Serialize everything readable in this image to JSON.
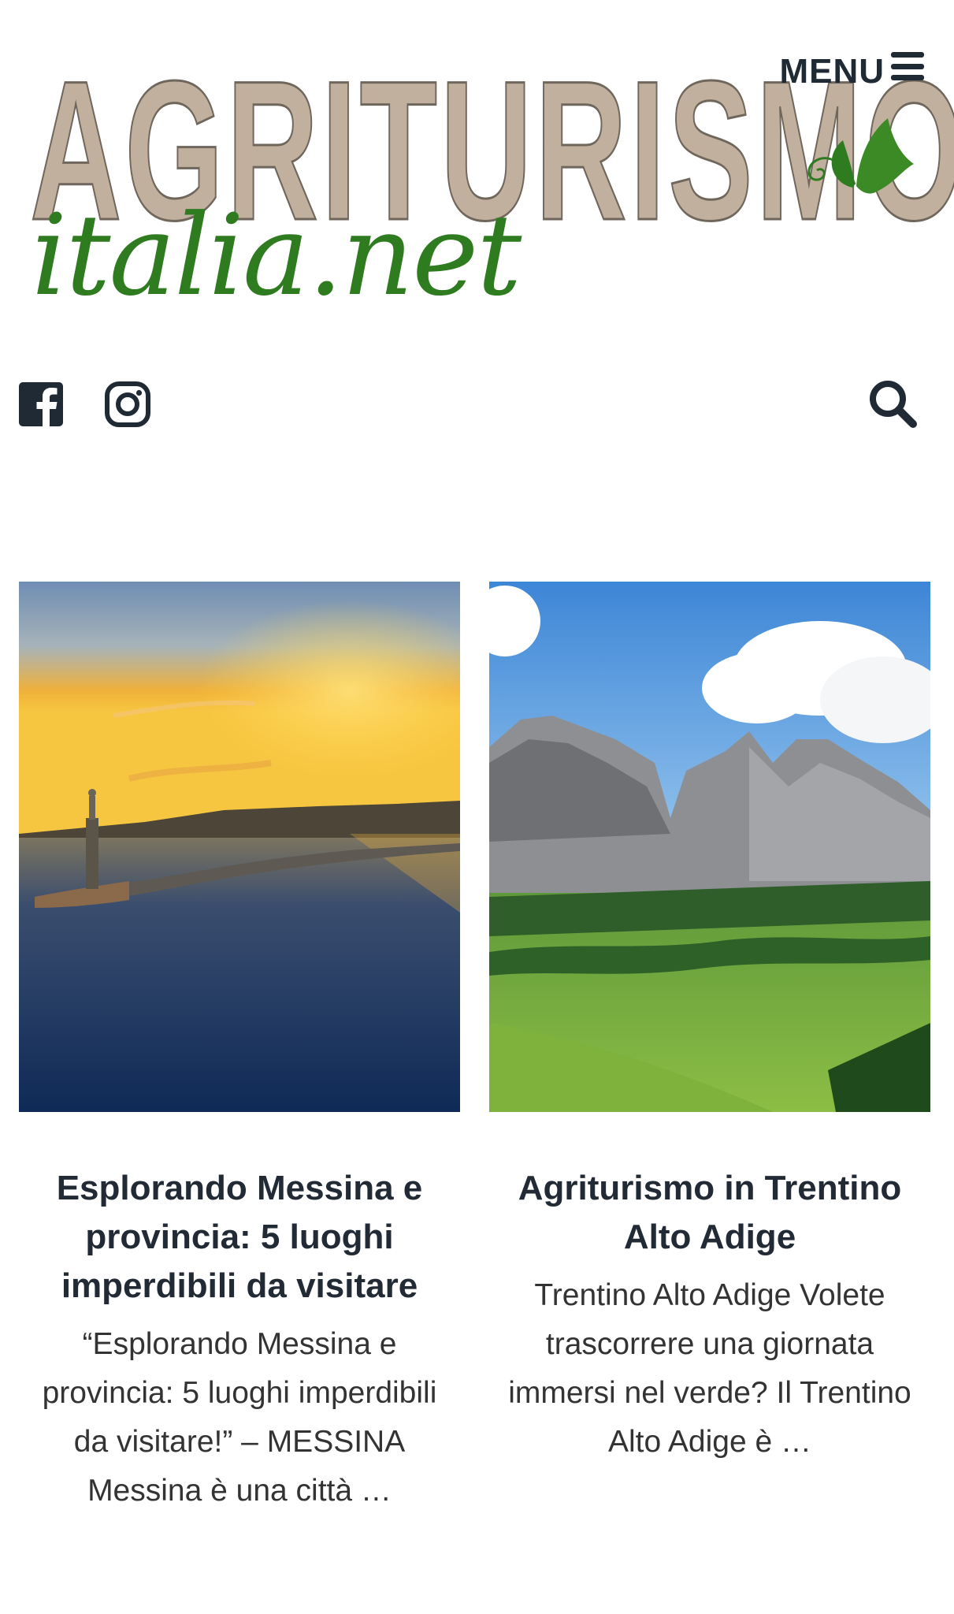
{
  "header": {
    "logo": {
      "wordmark": "AGRITURISMO",
      "subtitle": "italia.net"
    },
    "menu_label": "MENU",
    "menu_icon": "hamburger-icon"
  },
  "social": {
    "facebook_icon": "facebook-icon",
    "instagram_icon": "instagram-icon"
  },
  "search": {
    "icon": "search-icon"
  },
  "colors": {
    "logo_beige": "#c2b09e",
    "logo_green": "#2f7b20",
    "text_dark": "#222b35"
  },
  "cards": [
    {
      "image_subject": "Messina harbor at sunset",
      "title": "Esplorando Messina e provincia: 5 luoghi imperdibili da visitare",
      "excerpt": "“Esplorando Messina e provincia: 5 luoghi imperdibili da visitare!” – MESSINA Messina è una città …"
    },
    {
      "image_subject": "Dolomites meadow in Trentino",
      "title": "Agriturismo in Trentino Alto Adige",
      "excerpt": "Trentino Alto Adige Volete trascorrere una giornata immersi nel verde? Il Trentino Alto Adige è …"
    }
  ]
}
